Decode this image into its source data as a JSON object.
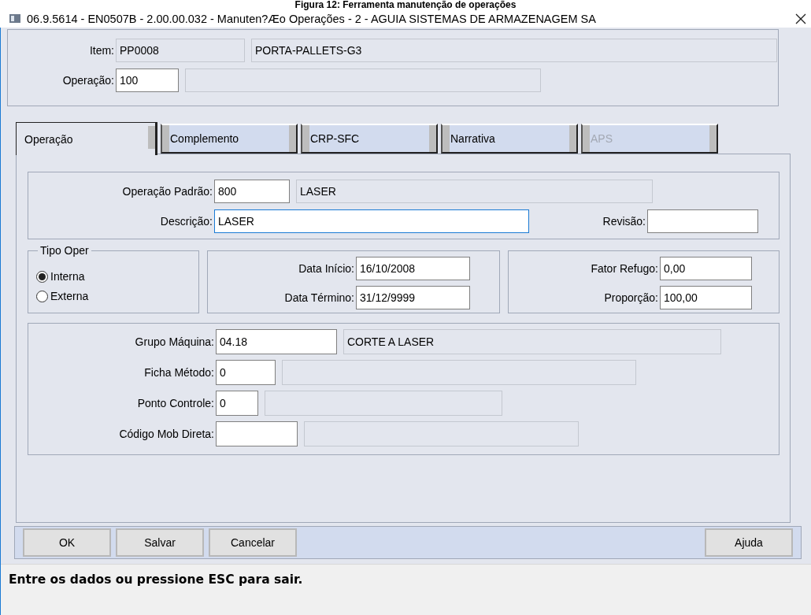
{
  "caption": "Figura 12: Ferramenta manutenção de operações",
  "window": {
    "title": "06.9.5614 - EN0507B - 2.00.00.032 - Manuten?Æo Operações - 2 - AGUIA SISTEMAS DE ARMAZENAGEM SA"
  },
  "header": {
    "rows": [
      {
        "label": "Item:",
        "value": "PP0008",
        "readonly": true,
        "description": "PORTA-PALLETS-G3"
      },
      {
        "label": "Operação:",
        "value": "100",
        "readonly": false
      }
    ]
  },
  "tabs": [
    {
      "label": "Operação",
      "selected": true,
      "disabled": false
    },
    {
      "label": "Complemento",
      "selected": false,
      "disabled": false
    },
    {
      "label": "CRP-SFC",
      "selected": false,
      "disabled": false
    },
    {
      "label": "Narrativa",
      "selected": false,
      "disabled": false
    },
    {
      "label": "APS",
      "selected": false,
      "disabled": true
    }
  ],
  "operation_section": {
    "rows": [
      {
        "label": "Operação Padrão:",
        "value": "800",
        "description": "LASER",
        "focused": false
      },
      {
        "label": "Descrição:",
        "value": "LASER",
        "focused": true
      }
    ],
    "revision_label": "Revisão:"
  },
  "tipo_oper": {
    "title": "Tipo Oper",
    "options": [
      {
        "label": "Interna",
        "selected": true
      },
      {
        "label": "Externa",
        "selected": false
      }
    ]
  },
  "dates": [
    {
      "label": "Data Início:",
      "value": "16/10/2008"
    },
    {
      "label": "Data Término:",
      "value": "31/12/9999"
    }
  ],
  "factors": [
    {
      "label": "Fator Refugo:",
      "value": "0,00"
    },
    {
      "label": "Proporção:",
      "value": "100,00"
    }
  ],
  "machine_section": {
    "rows": [
      {
        "label": "Grupo Máquina:",
        "value": "04.18",
        "description": "CORTE A LASER"
      },
      {
        "label": "Ficha Método:",
        "value": "0"
      },
      {
        "label": "Ponto Controle:",
        "value": "0"
      },
      {
        "label": "Código Mob Direta:"
      }
    ]
  },
  "buttons": [
    "OK",
    "Salvar",
    "Cancelar",
    "Ajuda"
  ],
  "status_bar": {
    "text": "Entre os dados ou pressione ESC para sair."
  }
}
